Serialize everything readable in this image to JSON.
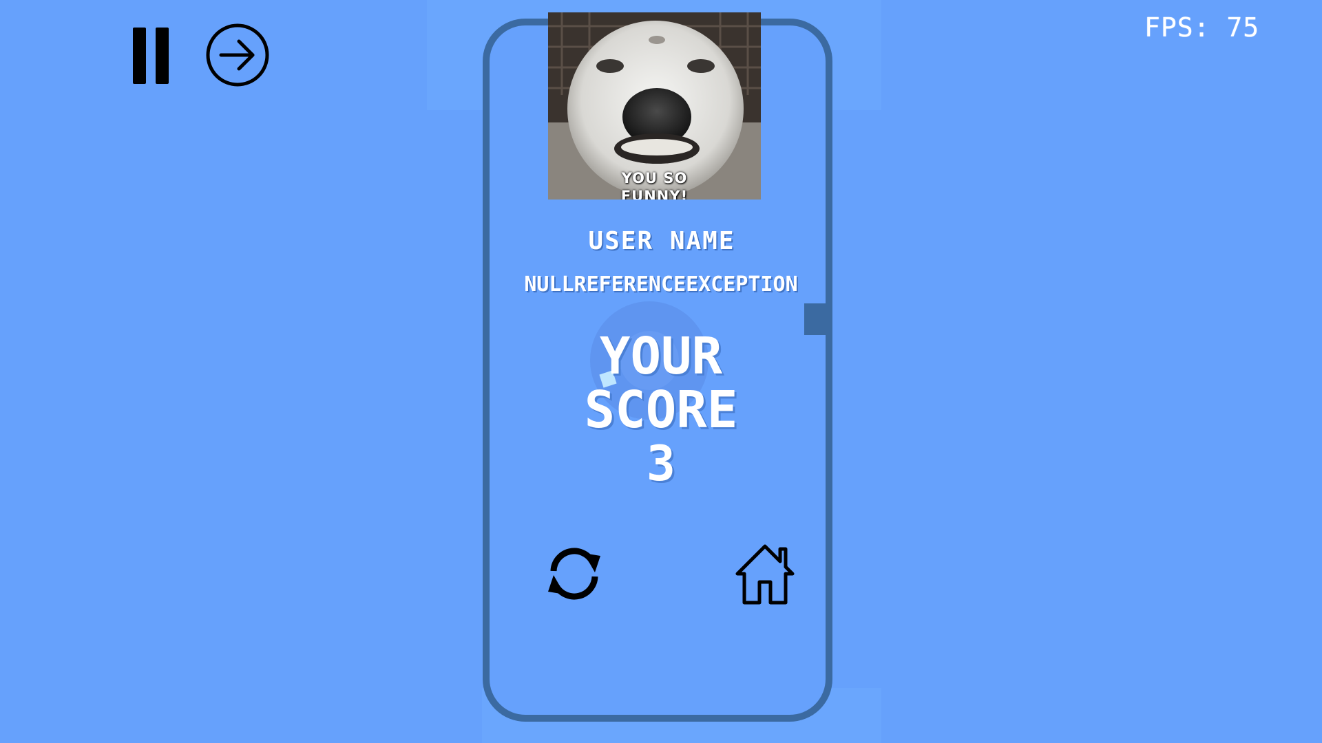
{
  "hud": {
    "fps_label": "FPS: 75",
    "pause_icon": "pause-icon",
    "next_icon": "arrow-right-circle-icon"
  },
  "meme": {
    "caption_line1": "YOU SO",
    "caption_line2": "FUNNY!"
  },
  "result": {
    "user_label": "USER NAME",
    "user_name": "NULLREFERENCEEXCEPTION",
    "score_line1": "YOUR",
    "score_line2": "SCORE",
    "score_value": "3"
  },
  "actions": {
    "restart_icon": "restart-icon",
    "home_icon": "home-icon"
  },
  "colors": {
    "background": "#66a1fc",
    "panel_border": "#3b6aa1",
    "text": "#ffffff"
  }
}
